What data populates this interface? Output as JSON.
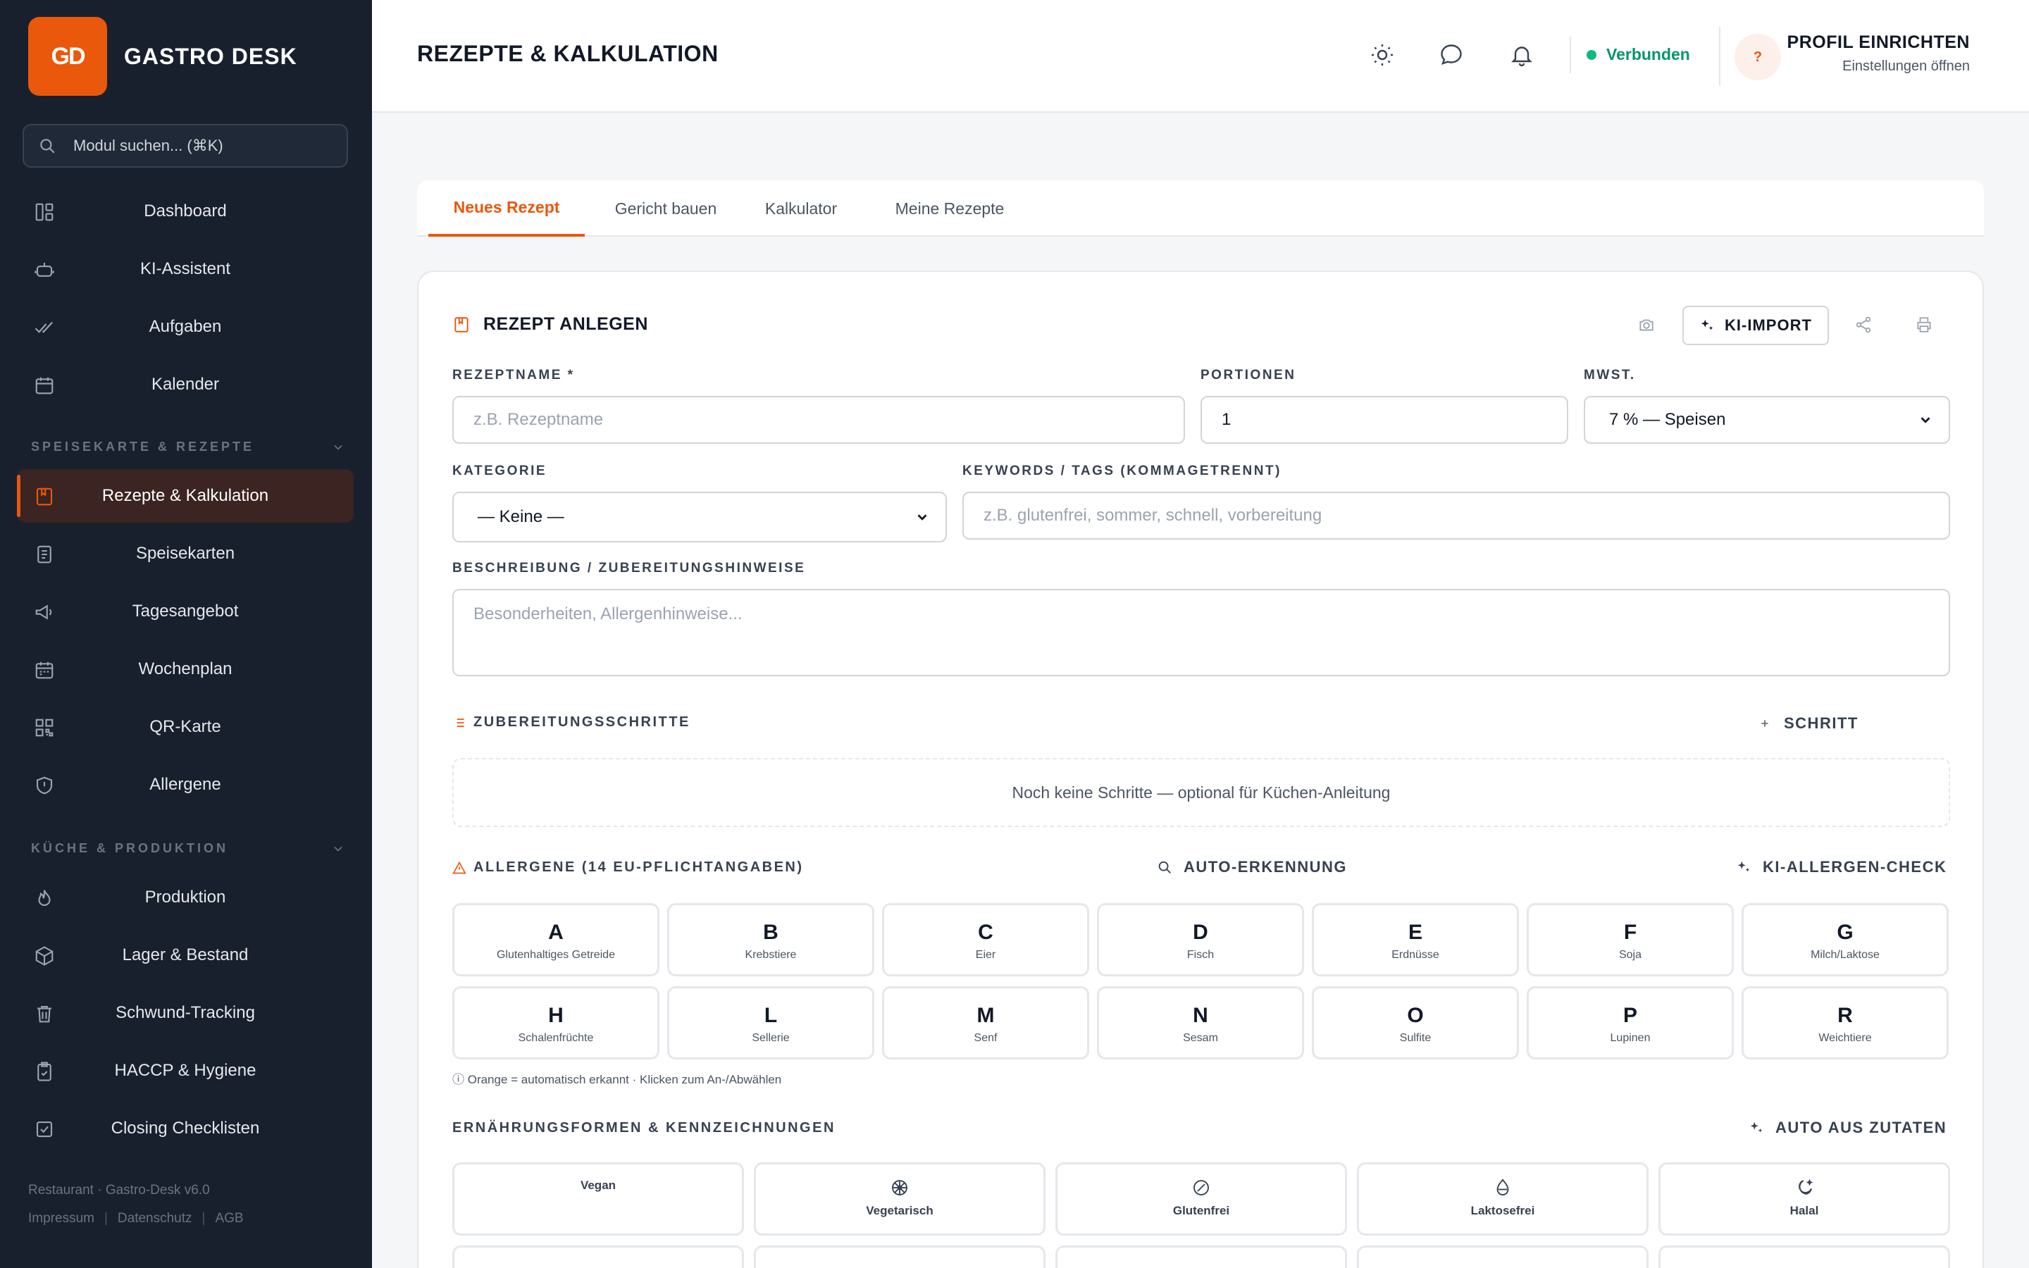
{
  "brand": {
    "logo_text": "GD",
    "name": "GASTRO DESK"
  },
  "search": {
    "placeholder": "Modul suchen... (⌘K)"
  },
  "nav": {
    "top": [
      {
        "label": "Dashboard",
        "icon": "dashboard-icon"
      },
      {
        "label": "KI-Assistent",
        "icon": "robot-icon"
      },
      {
        "label": "Aufgaben",
        "icon": "check-double-icon"
      },
      {
        "label": "Kalender",
        "icon": "calendar-icon"
      }
    ],
    "section1": {
      "title": "SPEISEKARTE & REZEPTE",
      "items": [
        {
          "label": "Rezepte & Kalkulation",
          "icon": "recipe-book-icon",
          "active": true
        },
        {
          "label": "Speisekarten",
          "icon": "menu-doc-icon"
        },
        {
          "label": "Tagesangebot",
          "icon": "megaphone-icon"
        },
        {
          "label": "Wochenplan",
          "icon": "calendar-week-icon"
        },
        {
          "label": "QR-Karte",
          "icon": "qr-code-icon"
        },
        {
          "label": "Allergene",
          "icon": "shield-icon"
        }
      ]
    },
    "section2": {
      "title": "KÜCHE & PRODUKTION",
      "items": [
        {
          "label": "Produktion",
          "icon": "flame-icon"
        },
        {
          "label": "Lager & Bestand",
          "icon": "box-icon"
        },
        {
          "label": "Schwund-Tracking",
          "icon": "trash-icon"
        },
        {
          "label": "HACCP & Hygiene",
          "icon": "clipboard-check-icon"
        },
        {
          "label": "Closing Checklisten",
          "icon": "checkbox-icon"
        }
      ]
    }
  },
  "footer": {
    "line1": "Restaurant · Gastro-Desk v6.0",
    "impressum": "Impressum",
    "datenschutz": "Datenschutz",
    "agb": "AGB"
  },
  "header": {
    "title": "REZEPTE & KALKULATION",
    "status": "Verbunden",
    "avatar": "?",
    "profile_title": "PROFIL EINRICHTEN",
    "profile_sub": "Einstellungen öffnen"
  },
  "tabs": [
    "Neues Rezept",
    "Gericht bauen",
    "Kalkulator",
    "Meine Rezepte"
  ],
  "form": {
    "title": "REZEPT ANLEGEN",
    "ki_import": "KI-IMPORT",
    "name_label": "REZEPTNAME *",
    "name_placeholder": "z.B. Rezeptname",
    "portions_label": "PORTIONEN",
    "portions_value": "1",
    "vat_label": "MWST.",
    "vat_value": "7 % — Speisen",
    "category_label": "KATEGORIE",
    "category_value": "— Keine —",
    "keywords_label": "KEYWORDS / TAGS (KOMMAGETRENNT)",
    "keywords_placeholder": "z.B. glutenfrei, sommer, schnell, vorbereitung",
    "desc_label": "BESCHREIBUNG / ZUBEREITUNGSHINWEISE",
    "desc_placeholder": "Besonderheiten, Allergenhinweise..."
  },
  "steps": {
    "title": "ZUBEREITUNGSSCHRITTE",
    "add": "SCHRITT",
    "empty": "Noch keine Schritte — optional für Küchen-Anleitung"
  },
  "allergens": {
    "title": "ALLERGENE (14 EU-PFLICHTANGABEN)",
    "auto": "AUTO-ERKENNUNG",
    "ki_check": "KI-ALLERGEN-CHECK",
    "hint": "ⓘ Orange = automatisch erkannt · Klicken zum An-/Abwählen",
    "items": [
      {
        "code": "A",
        "name": "Glutenhaltiges Getreide"
      },
      {
        "code": "B",
        "name": "Krebstiere"
      },
      {
        "code": "C",
        "name": "Eier"
      },
      {
        "code": "D",
        "name": "Fisch"
      },
      {
        "code": "E",
        "name": "Erdnüsse"
      },
      {
        "code": "F",
        "name": "Soja"
      },
      {
        "code": "G",
        "name": "Milch/Laktose"
      },
      {
        "code": "H",
        "name": "Schalenfrüchte"
      },
      {
        "code": "L",
        "name": "Sellerie"
      },
      {
        "code": "M",
        "name": "Senf"
      },
      {
        "code": "N",
        "name": "Sesam"
      },
      {
        "code": "O",
        "name": "Sulfite"
      },
      {
        "code": "P",
        "name": "Lupinen"
      },
      {
        "code": "R",
        "name": "Weichtiere"
      }
    ]
  },
  "diet": {
    "title": "ERNÄHRUNGSFORMEN & KENNZEICHNUNGEN",
    "auto": "AUTO AUS ZUTATEN",
    "items": [
      {
        "name": "Vegan",
        "icon": ""
      },
      {
        "name": "Vegetarisch",
        "icon": "flower-icon"
      },
      {
        "name": "Glutenfrei",
        "icon": "no-gluten-icon"
      },
      {
        "name": "Laktosefrei",
        "icon": "drop-icon"
      },
      {
        "name": "Halal",
        "icon": "moon-star-icon"
      }
    ]
  }
}
